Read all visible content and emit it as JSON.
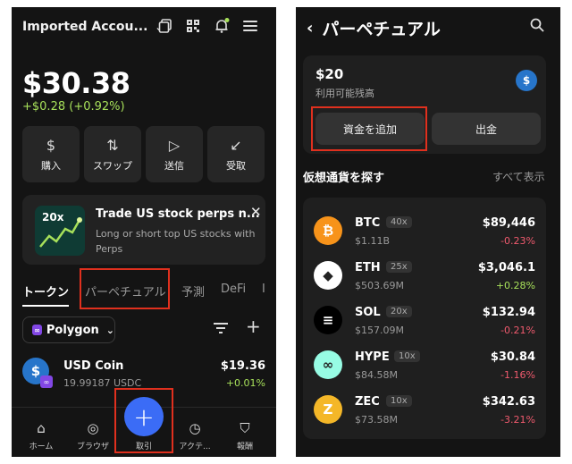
{
  "left": {
    "account_name": "Imported Accou...",
    "balance": "$30.38",
    "change": "+$0.28 (+0.92%)",
    "actions": [
      {
        "label": "購入",
        "icon": "dollar-icon"
      },
      {
        "label": "スワップ",
        "icon": "swap-icon"
      },
      {
        "label": "送信",
        "icon": "send-icon"
      },
      {
        "label": "受取",
        "icon": "receive-icon"
      }
    ],
    "promo": {
      "badge": "20x",
      "title": "Trade US stock perps n...",
      "description": "Long or short top US stocks with Perps"
    },
    "tabs": [
      "トークン",
      "パーペチュアル",
      "予測",
      "DeFi",
      "I"
    ],
    "chain": "Polygon",
    "token": {
      "name": "USD Coin",
      "amount": "19.99187 USDC",
      "value": "$19.36",
      "change": "+0.01%"
    },
    "nav": [
      "ホーム",
      "ブラウザ",
      "取引",
      "アクテ...",
      "報酬"
    ]
  },
  "right": {
    "title": "パーペチュアル",
    "amount": "$20",
    "available_label": "利用可能残高",
    "add_funds": "資金を追加",
    "withdraw": "出金",
    "section_title": "仮想通貨を探す",
    "see_all": "すべて表示",
    "coins": [
      {
        "symbol": "BTC",
        "leverage": "40x",
        "volume": "$1.11B",
        "price": "$89,446",
        "change": "-0.23%",
        "positive": false,
        "color": "#f7931a",
        "glyph": "₿"
      },
      {
        "symbol": "ETH",
        "leverage": "25x",
        "volume": "$503.69M",
        "price": "$3,046.1",
        "change": "+0.28%",
        "positive": true,
        "color": "#ffffff",
        "glyph": "◆"
      },
      {
        "symbol": "SOL",
        "leverage": "20x",
        "volume": "$157.09M",
        "price": "$132.94",
        "change": "-0.21%",
        "positive": false,
        "color": "#000000",
        "glyph": "≡"
      },
      {
        "symbol": "HYPE",
        "leverage": "10x",
        "volume": "$84.58M",
        "price": "$30.84",
        "change": "-1.16%",
        "positive": false,
        "color": "#97fce4",
        "glyph": "∞"
      },
      {
        "symbol": "ZEC",
        "leverage": "10x",
        "volume": "$73.58M",
        "price": "$342.63",
        "change": "-3.21%",
        "positive": false,
        "color": "#f4b728",
        "glyph": "Z"
      }
    ]
  },
  "colors": {
    "accent": "#3b6cf6",
    "positive": "#a7e05a",
    "negative": "#f05a6e",
    "highlight": "#e0301e"
  }
}
